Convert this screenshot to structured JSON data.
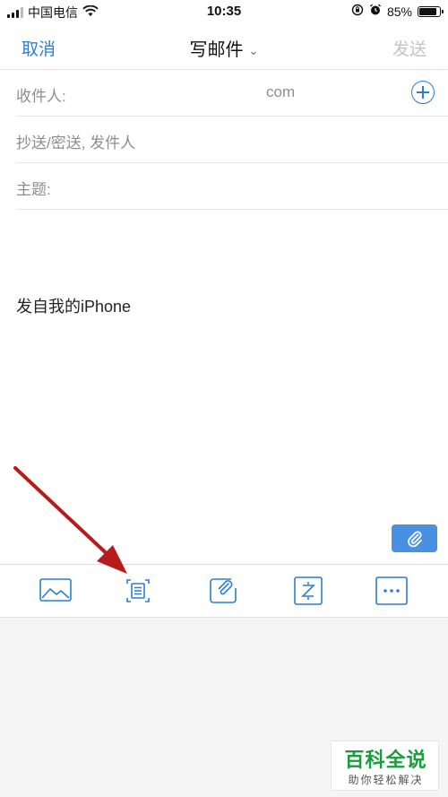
{
  "status_bar": {
    "carrier": "中国电信",
    "time": "10:35",
    "battery": "85%",
    "battery_level": 0.85
  },
  "nav": {
    "cancel_label": "取消",
    "title": "写邮件",
    "send_label": "发送"
  },
  "fields": {
    "to_label": "收件人:",
    "cc_label": "抄送/密送, 发件人",
    "cc_value": "com",
    "subject_label": "主题:"
  },
  "body": {
    "signature": "发自我的iPhone"
  },
  "toolbar": {
    "items": [
      "image-icon",
      "scan-document-icon",
      "attachment-icon",
      "compress-icon",
      "more-icon"
    ]
  },
  "watermark": {
    "title": "百科全说",
    "subtitle": "助你轻松解决"
  },
  "colors": {
    "accent": "#2d7dd2",
    "disabled": "#c3c3c3",
    "arrow": "#b71c1c",
    "watermark_green": "#1a9b3c"
  }
}
